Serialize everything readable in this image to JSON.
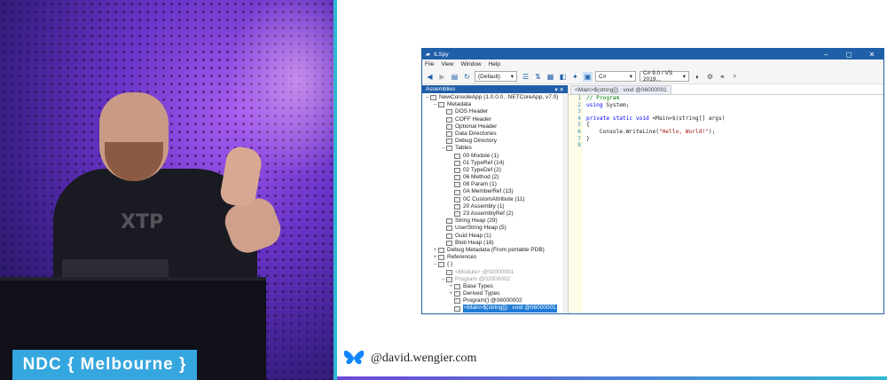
{
  "banner": {
    "text": "NDC { Melbourne }"
  },
  "social": {
    "handle": "@david.wengier.com",
    "icon": "butterfly-icon"
  },
  "window": {
    "title": "ILSpy",
    "menu": [
      "File",
      "View",
      "Window",
      "Help"
    ],
    "toolbar": {
      "assembly_list": "(Default)",
      "language": "C#",
      "version": "C# 9.0 / VS 2019..."
    },
    "assemblies_header": "Assemblies",
    "tree": [
      {
        "indent": 0,
        "toggle": "–",
        "label": "NewConsoleApp (1.0.0.0, .NETCoreApp, v7.0)"
      },
      {
        "indent": 1,
        "toggle": "–",
        "label": "Metadata"
      },
      {
        "indent": 2,
        "toggle": "",
        "label": "DOS Header"
      },
      {
        "indent": 2,
        "toggle": "",
        "label": "COFF Header"
      },
      {
        "indent": 2,
        "toggle": "",
        "label": "Optional Header"
      },
      {
        "indent": 2,
        "toggle": "",
        "label": "Data Directories"
      },
      {
        "indent": 2,
        "toggle": "",
        "label": "Debug Directory"
      },
      {
        "indent": 2,
        "toggle": "–",
        "label": "Tables"
      },
      {
        "indent": 3,
        "toggle": "",
        "label": "00 Module (1)"
      },
      {
        "indent": 3,
        "toggle": "",
        "label": "01 TypeRef (14)"
      },
      {
        "indent": 3,
        "toggle": "",
        "label": "02 TypeDef (2)"
      },
      {
        "indent": 3,
        "toggle": "",
        "label": "06 Method (2)"
      },
      {
        "indent": 3,
        "toggle": "",
        "label": "08 Param (1)"
      },
      {
        "indent": 3,
        "toggle": "",
        "label": "0A MemberRef (13)"
      },
      {
        "indent": 3,
        "toggle": "",
        "label": "0C CustomAttribute (11)"
      },
      {
        "indent": 3,
        "toggle": "",
        "label": "20 Assembly (1)"
      },
      {
        "indent": 3,
        "toggle": "",
        "label": "23 AssemblyRef (2)"
      },
      {
        "indent": 2,
        "toggle": "",
        "label": "String Heap (29)"
      },
      {
        "indent": 2,
        "toggle": "",
        "label": "UserString Heap (5)"
      },
      {
        "indent": 2,
        "toggle": "",
        "label": "Guid Heap (1)"
      },
      {
        "indent": 2,
        "toggle": "",
        "label": "Blob Heap (18)"
      },
      {
        "indent": 1,
        "toggle": "+",
        "label": "Debug Metadata (From portable PDB)"
      },
      {
        "indent": 1,
        "toggle": "+",
        "label": "References"
      },
      {
        "indent": 1,
        "toggle": "–",
        "label": "{ }"
      },
      {
        "indent": 2,
        "toggle": "",
        "label": "<Module> @02000001",
        "gray": true
      },
      {
        "indent": 2,
        "toggle": "–",
        "label": "Program @02000002",
        "gray": true
      },
      {
        "indent": 3,
        "toggle": "+",
        "label": "Base Types"
      },
      {
        "indent": 3,
        "toggle": "+",
        "label": "Derived Types"
      },
      {
        "indent": 3,
        "toggle": "",
        "label": "Program() @06000002"
      },
      {
        "indent": 3,
        "toggle": "",
        "label": "<Main>$(string[]) : void @06000001",
        "selected": true
      }
    ],
    "tab_label": "<Main>$(string[]) : void @06000001",
    "line_numbers": [
      "1",
      "2",
      "3",
      "4",
      "5",
      "6",
      "7",
      "8"
    ],
    "code": {
      "l1": "// Program",
      "l2_kw": "using",
      "l2_rest": " System;",
      "l4_kw": "private static void",
      "l4_rest": " <Main>$(string[] args)",
      "l5": "{",
      "l6_a": "    Console.WriteLine(",
      "l6_str": "\"Hello, World!\"",
      "l6_b": ");",
      "l7": "}"
    }
  }
}
